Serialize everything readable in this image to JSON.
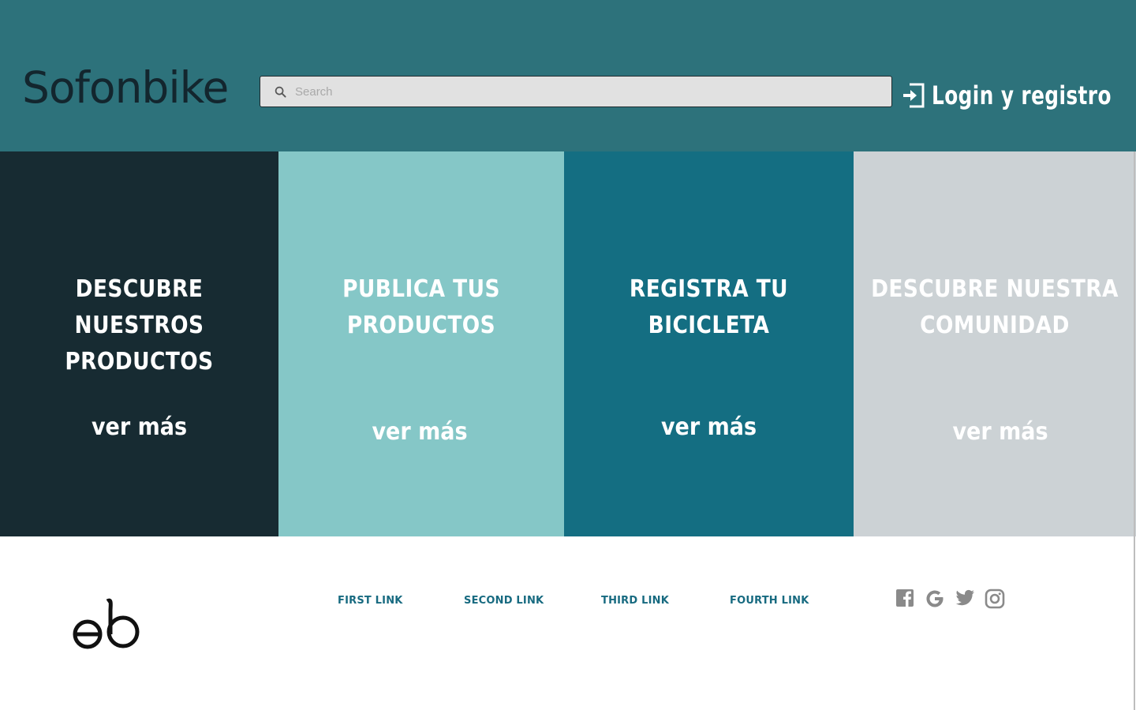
{
  "header": {
    "brand": "Sofonbike",
    "search": {
      "placeholder": "Search",
      "value": ""
    },
    "login_label": "Login y registro"
  },
  "panels": [
    {
      "title_line1": "DESCUBRE NUESTROS",
      "title_line2": "PRODUCTOS",
      "more": "ver más",
      "color": "#172b32"
    },
    {
      "title_line1": "PUBLICA TUS",
      "title_line2": "PRODUCTOS",
      "more": "ver más",
      "color": "#85c7c7"
    },
    {
      "title_line1": "REGISTRA TU",
      "title_line2": "BICICLETA",
      "more": "ver más",
      "color": "#146e82"
    },
    {
      "title_line1": "DESCUBRE NUESTRA",
      "title_line2": "COMUNIDAD",
      "more": "ver más",
      "color": "#ccd2d5"
    }
  ],
  "footer": {
    "links": [
      "FIRST LINK",
      "SECOND LINK",
      "THIRD LINK",
      "FOURTH LINK"
    ],
    "social_icons": [
      "facebook-icon",
      "google-icon",
      "twitter-icon",
      "instagram-icon"
    ]
  },
  "colors": {
    "header_bg": "#2d727b",
    "link": "#176a80",
    "social_icon": "#8a8a8a"
  }
}
